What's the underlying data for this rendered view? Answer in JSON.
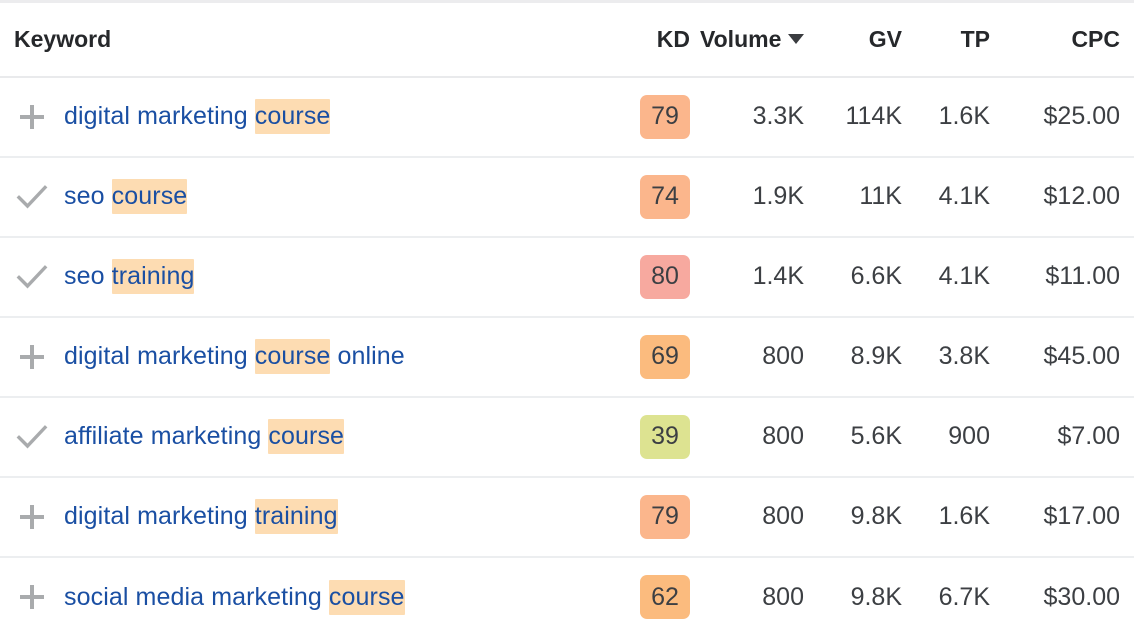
{
  "table": {
    "columns": [
      {
        "key": "keyword",
        "label": "Keyword",
        "align": "left"
      },
      {
        "key": "kd",
        "label": "KD",
        "align": "right"
      },
      {
        "key": "volume",
        "label": "Volume",
        "align": "right",
        "sorted": true,
        "sort_dir": "desc",
        "sort_icon": "caret-down-icon"
      },
      {
        "key": "gv",
        "label": "GV",
        "align": "right"
      },
      {
        "key": "tp",
        "label": "TP",
        "align": "right"
      },
      {
        "key": "cpc",
        "label": "CPC",
        "align": "right"
      }
    ],
    "rows": [
      {
        "action_icon": "plus-icon",
        "action_state": "add",
        "keyword_parts": [
          {
            "text": "digital marketing ",
            "highlight": false
          },
          {
            "text": "course",
            "highlight": true
          }
        ],
        "keyword_text": "digital marketing course",
        "kd": "79",
        "kd_color": "#fbb68c",
        "volume": "3.3K",
        "gv": "114K",
        "tp": "1.6K",
        "cpc": "$25.00"
      },
      {
        "action_icon": "check-icon",
        "action_state": "added",
        "keyword_parts": [
          {
            "text": "seo ",
            "highlight": false
          },
          {
            "text": "course",
            "highlight": true
          }
        ],
        "keyword_text": "seo course",
        "kd": "74",
        "kd_color": "#fbb68c",
        "volume": "1.9K",
        "gv": "11K",
        "tp": "4.1K",
        "cpc": "$12.00"
      },
      {
        "action_icon": "check-icon",
        "action_state": "added",
        "keyword_parts": [
          {
            "text": "seo ",
            "highlight": false
          },
          {
            "text": "training",
            "highlight": true
          }
        ],
        "keyword_text": "seo training",
        "kd": "80",
        "kd_color": "#f7a99f",
        "volume": "1.4K",
        "gv": "6.6K",
        "tp": "4.1K",
        "cpc": "$11.00"
      },
      {
        "action_icon": "plus-icon",
        "action_state": "add",
        "keyword_parts": [
          {
            "text": "digital marketing ",
            "highlight": false
          },
          {
            "text": "course",
            "highlight": true
          },
          {
            "text": " online",
            "highlight": false
          }
        ],
        "keyword_text": "digital marketing course online",
        "kd": "69",
        "kd_color": "#fbbb7e",
        "volume": "800",
        "gv": "8.9K",
        "tp": "3.8K",
        "cpc": "$45.00"
      },
      {
        "action_icon": "check-icon",
        "action_state": "added",
        "keyword_parts": [
          {
            "text": "affiliate marketing ",
            "highlight": false
          },
          {
            "text": "course",
            "highlight": true
          }
        ],
        "keyword_text": "affiliate marketing course",
        "kd": "39",
        "kd_color": "#dde391",
        "volume": "800",
        "gv": "5.6K",
        "tp": "900",
        "cpc": "$7.00"
      },
      {
        "action_icon": "plus-icon",
        "action_state": "add",
        "keyword_parts": [
          {
            "text": "digital marketing ",
            "highlight": false
          },
          {
            "text": "training",
            "highlight": true
          }
        ],
        "keyword_text": "digital marketing training",
        "kd": "79",
        "kd_color": "#fbb68c",
        "volume": "800",
        "gv": "9.8K",
        "tp": "1.6K",
        "cpc": "$17.00"
      },
      {
        "action_icon": "plus-icon",
        "action_state": "add",
        "keyword_parts": [
          {
            "text": "social media marketing ",
            "highlight": false
          },
          {
            "text": "course",
            "highlight": true
          }
        ],
        "keyword_text": "social media marketing course",
        "kd": "62",
        "kd_color": "#fbbb7e",
        "volume": "800",
        "gv": "9.8K",
        "tp": "6.7K",
        "cpc": "$30.00"
      }
    ]
  },
  "colors": {
    "link": "#1a4fa3",
    "highlight": "#fddcb2",
    "text": "#3c3f43",
    "header_text": "#26282b",
    "divider": "#eceef0",
    "icon_gray": "#a9abad"
  }
}
